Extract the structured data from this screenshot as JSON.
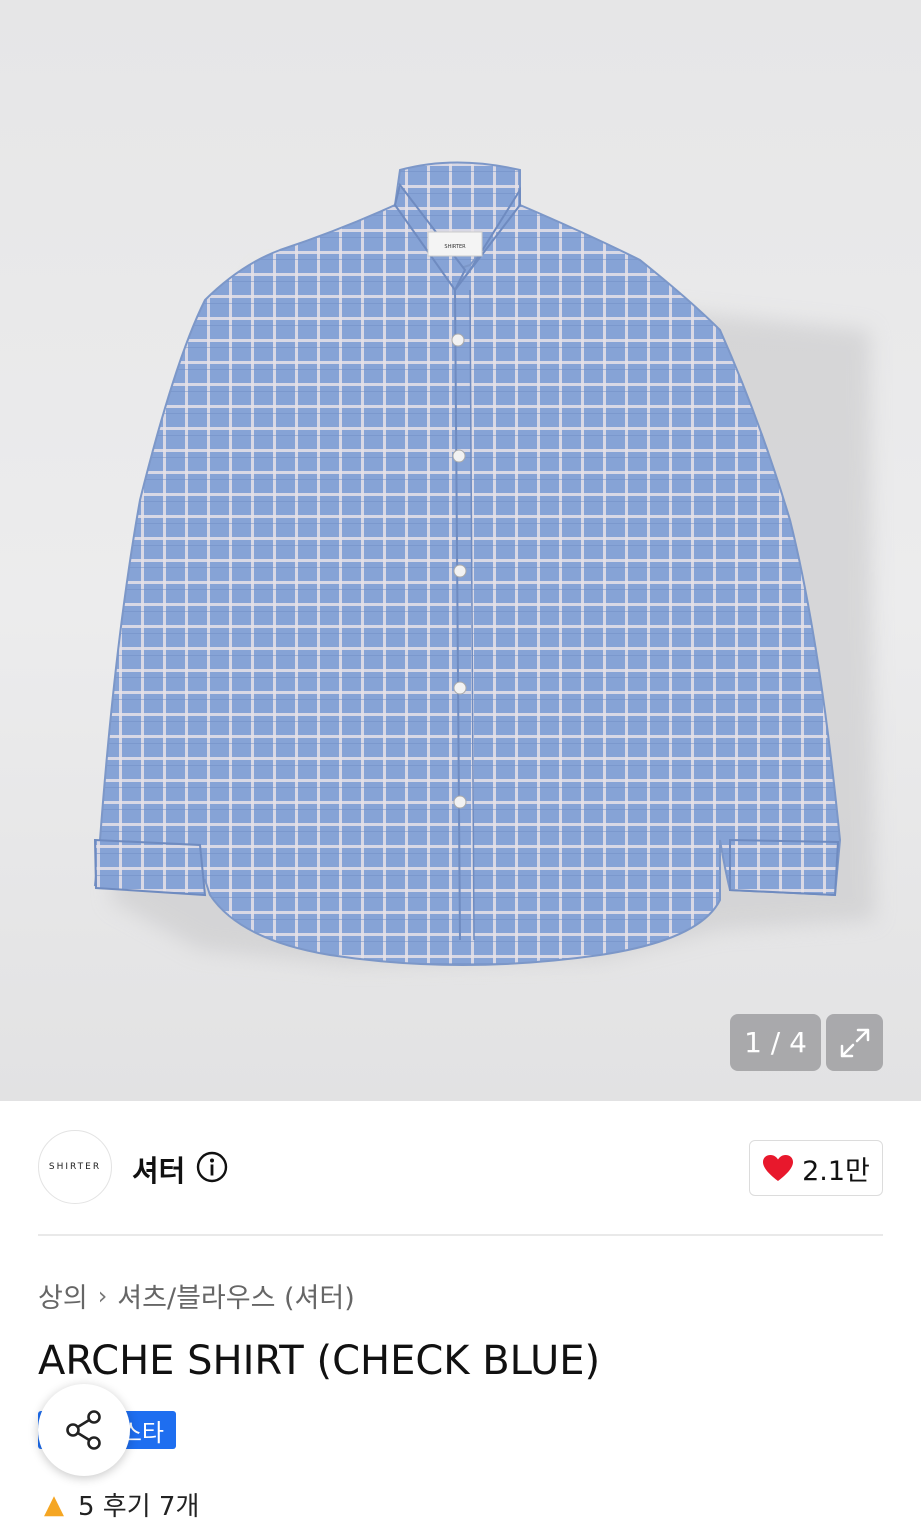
{
  "gallery": {
    "counter": "1 / 4",
    "shirt_label_text": "SHIRTER"
  },
  "brand": {
    "logo_text": "SHIRTER",
    "name": "셔터",
    "like_count": "2.1만"
  },
  "breadcrumb": {
    "category": "상의",
    "subcategory": "셔츠/블라우스 (셔터)"
  },
  "product": {
    "title": "ARCHE SHIRT (CHECK BLUE)",
    "badge_text": "스타"
  },
  "reviews": {
    "text": "5 후기 7개"
  },
  "colors": {
    "accent": "#1e6ef0",
    "heart": "#e8182c",
    "shirt": "#8aa6d6"
  }
}
